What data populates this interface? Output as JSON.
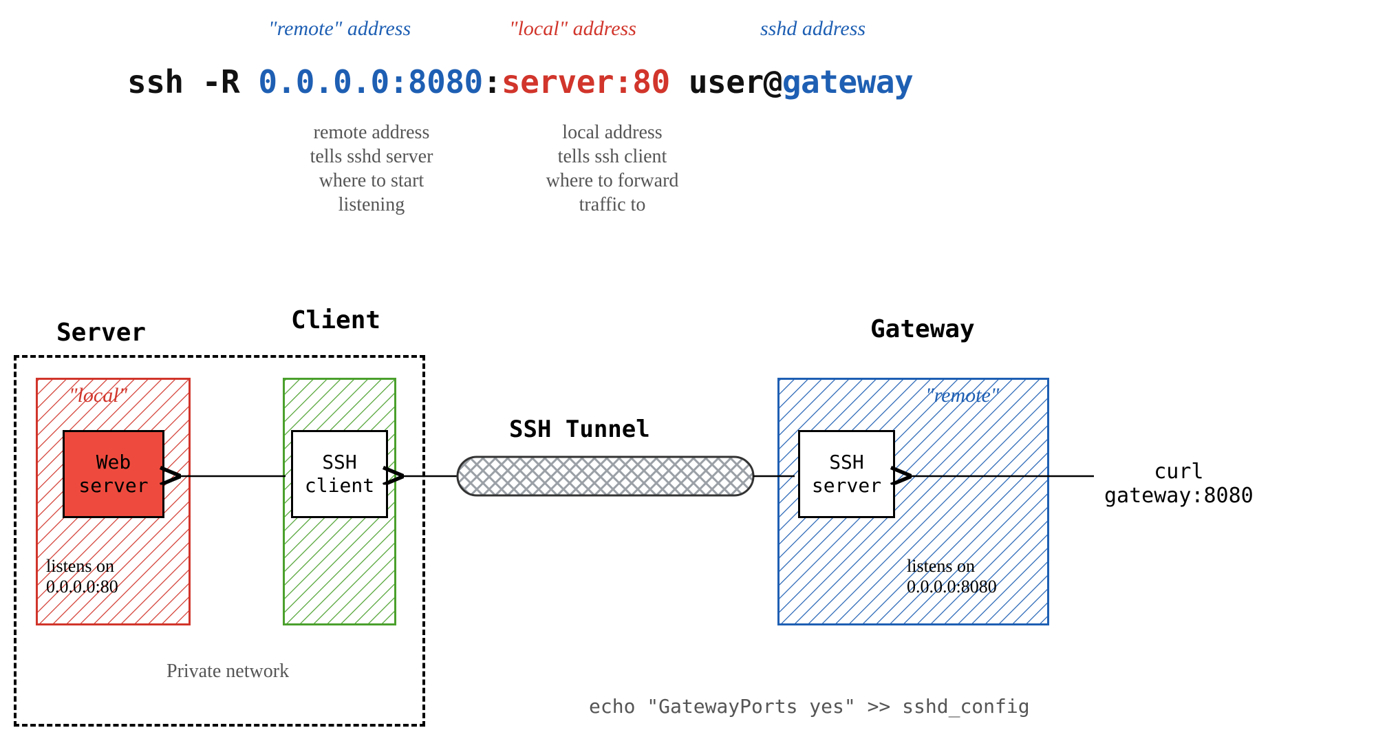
{
  "top_labels": {
    "remote": "\"remote\" address",
    "local": "\"local\" address",
    "sshd": "sshd address"
  },
  "cmd": {
    "prefix": "ssh -R ",
    "remote_addr": "0.0.0.0:8080",
    "sep": ":",
    "local_addr": "server:80",
    "user": " user@",
    "gateway": "gateway"
  },
  "explain": {
    "remote": "remote address\ntells sshd server\nwhere to start\nlistening",
    "local": "local address\ntells ssh client\nwhere to forward\ntraffic to"
  },
  "machines": {
    "server": "Server",
    "client": "Client",
    "gateway": "Gateway"
  },
  "server_box": {
    "title": "\"local\"",
    "inner": "Web\nserver",
    "listens": "listens on\n0.0.0.0:80"
  },
  "client_box": {
    "inner": "SSH\nclient"
  },
  "gateway_box": {
    "title": "\"remote\"",
    "inner": "SSH\nserver",
    "listens": "listens on\n0.0.0.0:8080"
  },
  "tunnel_label": "SSH Tunnel",
  "curl": "curl\ngateway:8080",
  "private_network": "Private network",
  "footer": "echo \"GatewayPorts yes\" >> sshd_config",
  "colors": {
    "blue": "#1e5fb3",
    "red": "#d1352b",
    "green": "#4aa02c",
    "grey": "#555"
  }
}
